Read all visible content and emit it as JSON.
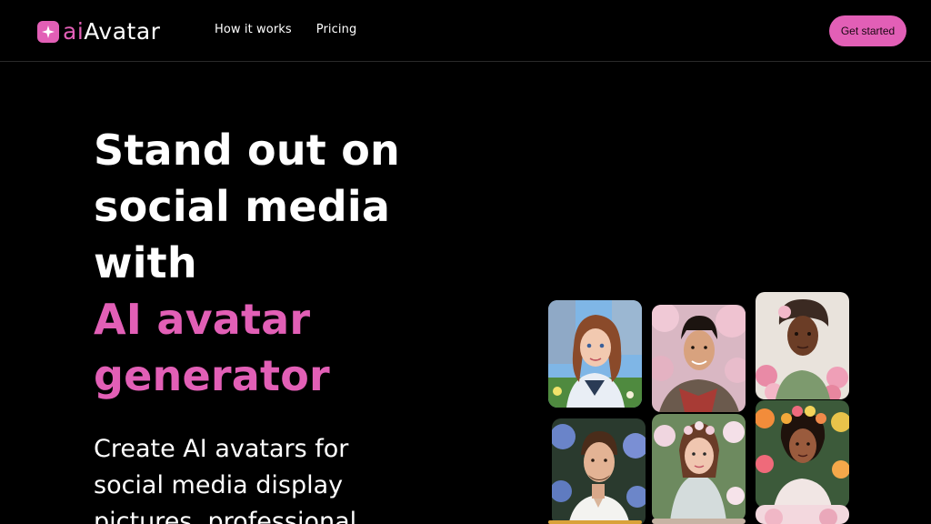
{
  "header": {
    "logo_ai": "ai",
    "logo_rest": "Avatar",
    "nav": [
      {
        "label": "How it works"
      },
      {
        "label": "Pricing"
      }
    ],
    "cta_label": "Get started"
  },
  "hero": {
    "title_lines": [
      "Stand out on",
      "social media",
      "with"
    ],
    "title_accent_lines": [
      "AI avatar",
      "generator"
    ],
    "subtitle": "Create AI avatars for social media display pictures, professional"
  },
  "colors": {
    "accent": "#e25fb6",
    "background": "#000000"
  },
  "gallery": {
    "icons": [
      "avatar-woman-city",
      "avatar-man-samurai",
      "avatar-woman-flowers",
      "avatar-man-hydrangea",
      "avatar-woman-veil",
      "avatar-woman-floral-crown",
      "avatar-partial"
    ]
  }
}
